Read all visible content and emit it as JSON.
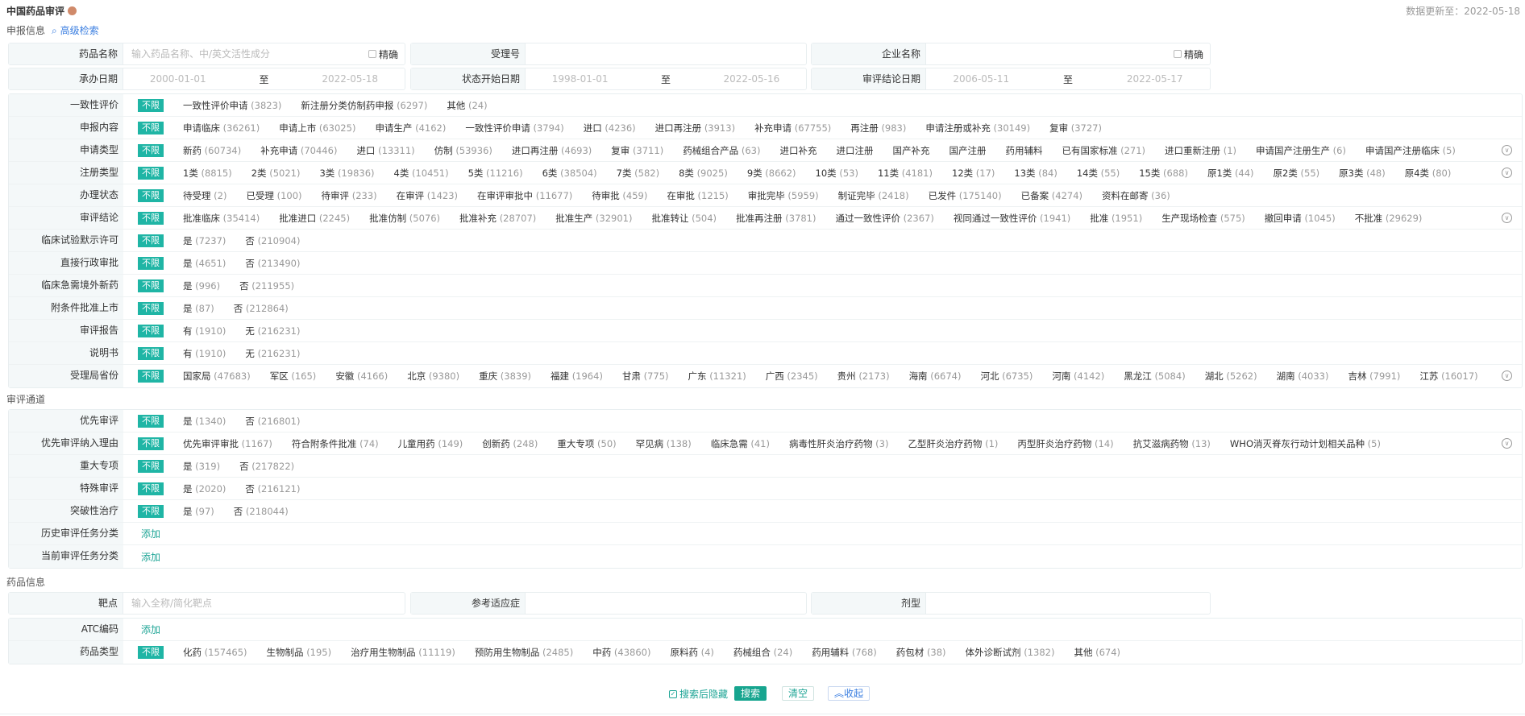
{
  "header": {
    "title": "中国药品审评",
    "updated": "数据更新至：2022-05-18"
  },
  "sections": {
    "declare": "申报信息",
    "advanced": "高级检索",
    "channel": "审评通道",
    "drug": "药品信息"
  },
  "fields": {
    "drug_name": {
      "label": "药品名称",
      "placeholder": "输入药品名称、中/英文活性成分",
      "exact": "精确"
    },
    "accept_no": {
      "label": "受理号"
    },
    "company": {
      "label": "企业名称",
      "exact": "精确"
    },
    "handle_date": {
      "label": "承办日期",
      "from": "2000-01-01",
      "to_label": "至",
      "to": "2022-05-18"
    },
    "status_date": {
      "label": "状态开始日期",
      "from": "1998-01-01",
      "to_label": "至",
      "to": "2022-05-16"
    },
    "conclusion_date": {
      "label": "审评结论日期",
      "from": "2006-05-11",
      "to_label": "至",
      "to": "2022-05-17"
    },
    "target": {
      "label": "靶点",
      "placeholder": "输入全称/简化靶点"
    },
    "indication": {
      "label": "参考适应症"
    },
    "dosage": {
      "label": "剂型"
    }
  },
  "unlimited": "不限",
  "add_label": "添加",
  "blocks": [
    [
      {
        "label": "一致性评价",
        "opts": [
          [
            "一致性评价申请",
            "(3823)"
          ],
          [
            "新注册分类仿制药申报",
            "(6297)"
          ],
          [
            "其他",
            "(24)"
          ]
        ]
      },
      {
        "label": "申报内容",
        "opts": [
          [
            "申请临床",
            "(36261)"
          ],
          [
            "申请上市",
            "(63025)"
          ],
          [
            "申请生产",
            "(4162)"
          ],
          [
            "一致性评价申请",
            "(3794)"
          ],
          [
            "进口",
            "(4236)"
          ],
          [
            "进口再注册",
            "(3913)"
          ],
          [
            "补充申请",
            "(67755)"
          ],
          [
            "再注册",
            "(983)"
          ],
          [
            "申请注册或补充",
            "(30149)"
          ],
          [
            "复审",
            "(3727)"
          ]
        ]
      },
      {
        "label": "申请类型",
        "expand": true,
        "opts": [
          [
            "新药",
            "(60734)"
          ],
          [
            "补充申请",
            "(70446)"
          ],
          [
            "进口",
            "(13311)"
          ],
          [
            "仿制",
            "(53936)"
          ],
          [
            "进口再注册",
            "(4693)"
          ],
          [
            "复审",
            "(3711)"
          ],
          [
            "药械组合产品",
            "(63)"
          ],
          [
            "进口补充",
            ""
          ],
          [
            "进口注册",
            ""
          ],
          [
            "国产补充",
            ""
          ],
          [
            "国产注册",
            ""
          ],
          [
            "药用辅料",
            ""
          ],
          [
            "已有国家标准",
            "(271)"
          ],
          [
            "进口重新注册",
            "(1)"
          ],
          [
            "申请国产注册生产",
            "(6)"
          ],
          [
            "申请国产注册临床",
            "(5)"
          ]
        ]
      },
      {
        "label": "注册类型",
        "expand": true,
        "opts": [
          [
            "1类",
            "(8815)"
          ],
          [
            "2类",
            "(5021)"
          ],
          [
            "3类",
            "(19836)"
          ],
          [
            "4类",
            "(10451)"
          ],
          [
            "5类",
            "(11216)"
          ],
          [
            "6类",
            "(38504)"
          ],
          [
            "7类",
            "(582)"
          ],
          [
            "8类",
            "(9025)"
          ],
          [
            "9类",
            "(8662)"
          ],
          [
            "10类",
            "(53)"
          ],
          [
            "11类",
            "(4181)"
          ],
          [
            "12类",
            "(17)"
          ],
          [
            "13类",
            "(84)"
          ],
          [
            "14类",
            "(55)"
          ],
          [
            "15类",
            "(688)"
          ],
          [
            "原1类",
            "(44)"
          ],
          [
            "原2类",
            "(55)"
          ],
          [
            "原3类",
            "(48)"
          ],
          [
            "原4类",
            "(80)"
          ]
        ]
      },
      {
        "label": "办理状态",
        "opts": [
          [
            "待受理",
            "(2)"
          ],
          [
            "已受理",
            "(100)"
          ],
          [
            "待审评",
            "(233)"
          ],
          [
            "在审评",
            "(1423)"
          ],
          [
            "在审评审批中",
            "(11677)"
          ],
          [
            "待审批",
            "(459)"
          ],
          [
            "在审批",
            "(1215)"
          ],
          [
            "审批完毕",
            "(5959)"
          ],
          [
            "制证完毕",
            "(2418)"
          ],
          [
            "已发件",
            "(175140)"
          ],
          [
            "已备案",
            "(4274)"
          ],
          [
            "资料在邮寄",
            "(36)"
          ]
        ]
      },
      {
        "label": "审评结论",
        "expand": true,
        "opts": [
          [
            "批准临床",
            "(35414)"
          ],
          [
            "批准进口",
            "(2245)"
          ],
          [
            "批准仿制",
            "(5076)"
          ],
          [
            "批准补充",
            "(28707)"
          ],
          [
            "批准生产",
            "(32901)"
          ],
          [
            "批准转让",
            "(504)"
          ],
          [
            "批准再注册",
            "(3781)"
          ],
          [
            "通过一致性评价",
            "(2367)"
          ],
          [
            "视同通过一致性评价",
            "(1941)"
          ],
          [
            "批准",
            "(1951)"
          ],
          [
            "生产现场检查",
            "(575)"
          ],
          [
            "撤回申请",
            "(1045)"
          ],
          [
            "不批准",
            "(29629)"
          ]
        ]
      },
      {
        "label": "临床试验默示许可",
        "opts": [
          [
            "是",
            "(7237)"
          ],
          [
            "否",
            "(210904)"
          ]
        ]
      },
      {
        "label": "直接行政审批",
        "opts": [
          [
            "是",
            "(4651)"
          ],
          [
            "否",
            "(213490)"
          ]
        ]
      },
      {
        "label": "临床急需境外新药",
        "opts": [
          [
            "是",
            "(996)"
          ],
          [
            "否",
            "(211955)"
          ]
        ]
      },
      {
        "label": "附条件批准上市",
        "opts": [
          [
            "是",
            "(87)"
          ],
          [
            "否",
            "(212864)"
          ]
        ]
      },
      {
        "label": "审评报告",
        "opts": [
          [
            "有",
            "(1910)"
          ],
          [
            "无",
            "(216231)"
          ]
        ]
      },
      {
        "label": "说明书",
        "opts": [
          [
            "有",
            "(1910)"
          ],
          [
            "无",
            "(216231)"
          ]
        ]
      },
      {
        "label": "受理局省份",
        "expand": true,
        "opts": [
          [
            "国家局",
            "(47683)"
          ],
          [
            "军区",
            "(165)"
          ],
          [
            "安徽",
            "(4166)"
          ],
          [
            "北京",
            "(9380)"
          ],
          [
            "重庆",
            "(3839)"
          ],
          [
            "福建",
            "(1964)"
          ],
          [
            "甘肃",
            "(775)"
          ],
          [
            "广东",
            "(11321)"
          ],
          [
            "广西",
            "(2345)"
          ],
          [
            "贵州",
            "(2173)"
          ],
          [
            "海南",
            "(6674)"
          ],
          [
            "河北",
            "(6735)"
          ],
          [
            "河南",
            "(4142)"
          ],
          [
            "黑龙江",
            "(5084)"
          ],
          [
            "湖北",
            "(5262)"
          ],
          [
            "湖南",
            "(4033)"
          ],
          [
            "吉林",
            "(7991)"
          ],
          [
            "江苏",
            "(16017)"
          ]
        ]
      }
    ],
    [
      {
        "label": "优先审评",
        "opts": [
          [
            "是",
            "(1340)"
          ],
          [
            "否",
            "(216801)"
          ]
        ]
      },
      {
        "label": "优先审评纳入理由",
        "expand": true,
        "opts": [
          [
            "优先审评审批",
            "(1167)"
          ],
          [
            "符合附条件批准",
            "(74)"
          ],
          [
            "儿童用药",
            "(149)"
          ],
          [
            "创新药",
            "(248)"
          ],
          [
            "重大专项",
            "(50)"
          ],
          [
            "罕见病",
            "(138)"
          ],
          [
            "临床急需",
            "(41)"
          ],
          [
            "病毒性肝炎治疗药物",
            "(3)"
          ],
          [
            "乙型肝炎治疗药物",
            "(1)"
          ],
          [
            "丙型肝炎治疗药物",
            "(14)"
          ],
          [
            "抗艾滋病药物",
            "(13)"
          ],
          [
            "WHO消灭脊灰行动计划相关品种",
            "(5)"
          ]
        ]
      },
      {
        "label": "重大专项",
        "opts": [
          [
            "是",
            "(319)"
          ],
          [
            "否",
            "(217822)"
          ]
        ]
      },
      {
        "label": "特殊审评",
        "opts": [
          [
            "是",
            "(2020)"
          ],
          [
            "否",
            "(216121)"
          ]
        ]
      },
      {
        "label": "突破性治疗",
        "opts": [
          [
            "是",
            "(97)"
          ],
          [
            "否",
            "(218044)"
          ]
        ]
      },
      {
        "label": "历史审评任务分类",
        "add": true
      },
      {
        "label": "当前审评任务分类",
        "add": true
      }
    ],
    [
      {
        "label": "ATC编码",
        "add": true
      },
      {
        "label": "药品类型",
        "opts": [
          [
            "化药",
            "(157465)"
          ],
          [
            "生物制品",
            "(195)"
          ],
          [
            "治疗用生物制品",
            "(11119)"
          ],
          [
            "预防用生物制品",
            "(2485)"
          ],
          [
            "中药",
            "(43860)"
          ],
          [
            "原料药",
            "(4)"
          ],
          [
            "药械组合",
            "(24)"
          ],
          [
            "药用辅料",
            "(768)"
          ],
          [
            "药包材",
            "(38)"
          ],
          [
            "体外诊断试剂",
            "(1382)"
          ],
          [
            "其他",
            "(674)"
          ]
        ]
      }
    ]
  ],
  "actions": {
    "hide_after_search": "搜索后隐藏",
    "search": "搜索",
    "clear": "清空",
    "collapse": "收起"
  },
  "colors": {
    "accent": "#1fb5a5",
    "link": "#3a7ee0"
  }
}
